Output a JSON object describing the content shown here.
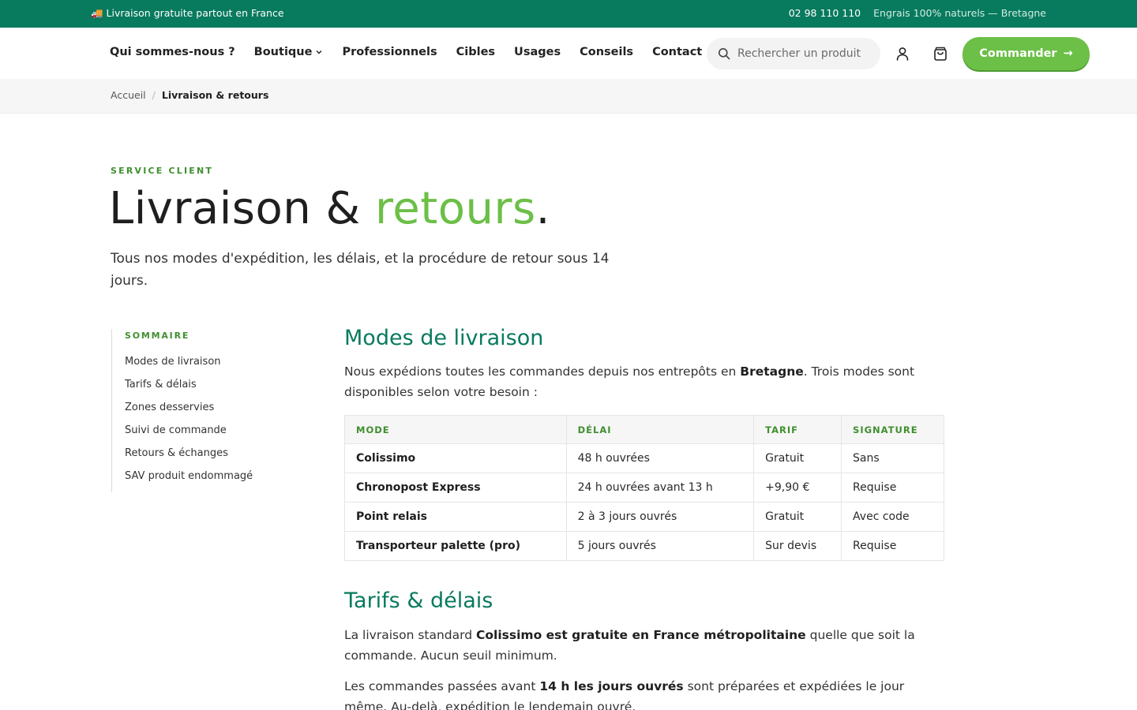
{
  "topbar": {
    "shipping_text": "🚚 Livraison gratuite partout en France",
    "phone": "02 98 110 110",
    "tagline": "Engrais 100% naturels — Bretagne"
  },
  "nav": {
    "items": [
      {
        "label": "Qui sommes-nous ?"
      },
      {
        "label": "Boutique",
        "has_dropdown": true
      },
      {
        "label": "Professionnels"
      },
      {
        "label": "Cibles"
      },
      {
        "label": "Usages"
      },
      {
        "label": "Conseils"
      },
      {
        "label": "Contact"
      }
    ],
    "search_placeholder": "Rechercher un produit",
    "account_icon": "user-icon",
    "cart_icon": "cart-icon",
    "cta_label": "Commander",
    "cta_arrow": "→"
  },
  "breadcrumb": {
    "home": "Accueil",
    "separator": "/",
    "current": "Livraison & retours"
  },
  "hero": {
    "eyebrow": "SERVICE CLIENT",
    "title_main": "Livraison & ",
    "title_accent": "retours",
    "title_end": ".",
    "subtitle": "Tous nos modes d'expédition, les délais, et la procédure de retour sous 14 jours."
  },
  "toc": {
    "label": "SOMMAIRE",
    "links": [
      "Modes de livraison",
      "Tarifs & délais",
      "Zones desservies",
      "Suivi de commande",
      "Retours & échanges",
      "SAV produit endommagé"
    ]
  },
  "modes": {
    "title": "Modes de livraison",
    "intro_before": "Nous expédions toutes les commandes depuis nos entrepôts en ",
    "intro_bold": "Bretagne",
    "intro_after": ". Trois modes sont disponibles selon votre besoin :",
    "columns": [
      "MODE",
      "DÉLAI",
      "TARIF",
      "SIGNATURE"
    ],
    "rows": [
      [
        "Colissimo",
        "48 h ouvrées",
        "Gratuit",
        "Sans"
      ],
      [
        "Chronopost Express",
        "24 h ouvrées avant 13 h",
        "+9,90 €",
        "Requise"
      ],
      [
        "Point relais",
        "2 à 3 jours ouvrés",
        "Gratuit",
        "Avec code"
      ],
      [
        "Transporteur palette (pro)",
        "5 jours ouvrés",
        "Sur devis",
        "Requise"
      ]
    ]
  },
  "tarifs": {
    "title": "Tarifs & délais",
    "p1_before": "La livraison standard ",
    "p1_bold": "Colissimo est gratuite en France métropolitaine",
    "p1_after": " quelle que soit la commande. Aucun seuil minimum.",
    "p2_before": "Les commandes passées avant ",
    "p2_bold": "14 h les jours ouvrés",
    "p2_after": " sont préparées et expédiées le jour même. Au-delà, expédition le lendemain ouvré."
  },
  "colors": {
    "brand_green": "#087a5e",
    "accent_green": "#6cbf47",
    "label_green": "#3f8f2e"
  }
}
